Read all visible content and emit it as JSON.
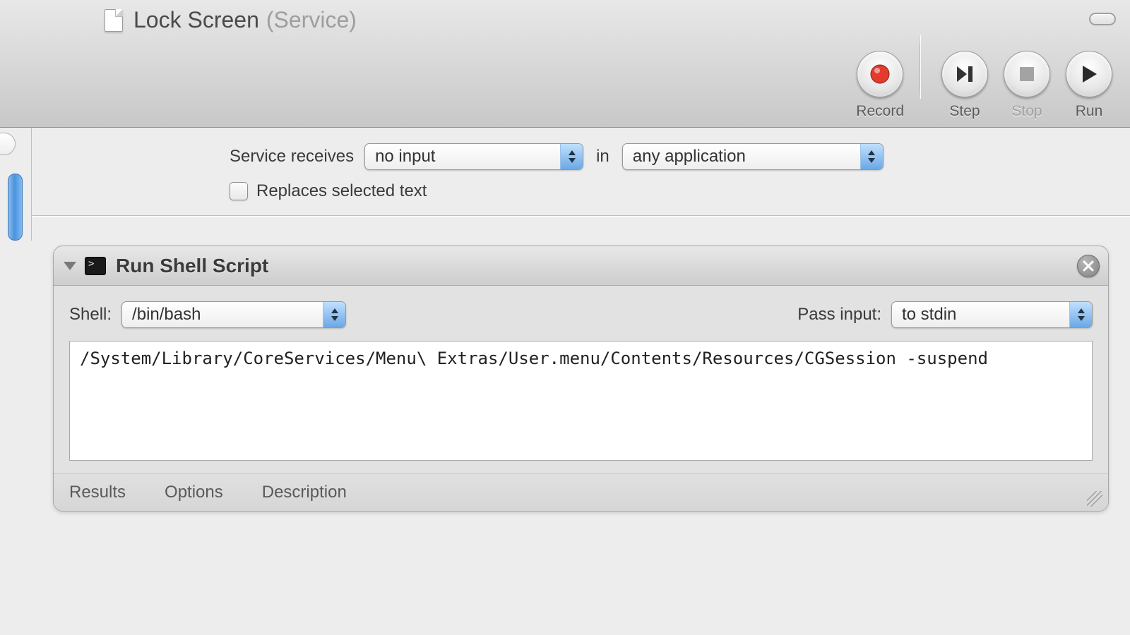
{
  "window": {
    "title": "Lock Screen",
    "subtitle": "(Service)"
  },
  "toolbar": {
    "record": "Record",
    "step": "Step",
    "stop": "Stop",
    "run": "Run"
  },
  "service": {
    "receives_label": "Service receives",
    "input_value": "no input",
    "in_label": "in",
    "app_value": "any application",
    "replaces_label": "Replaces selected text"
  },
  "action": {
    "title": "Run Shell Script",
    "shell_label": "Shell:",
    "shell_value": "/bin/bash",
    "pass_label": "Pass input:",
    "pass_value": "to stdin",
    "script": "/System/Library/CoreServices/Menu\\ Extras/User.menu/Contents/Resources/CGSession -suspend",
    "tabs": {
      "results": "Results",
      "options": "Options",
      "description": "Description"
    }
  }
}
